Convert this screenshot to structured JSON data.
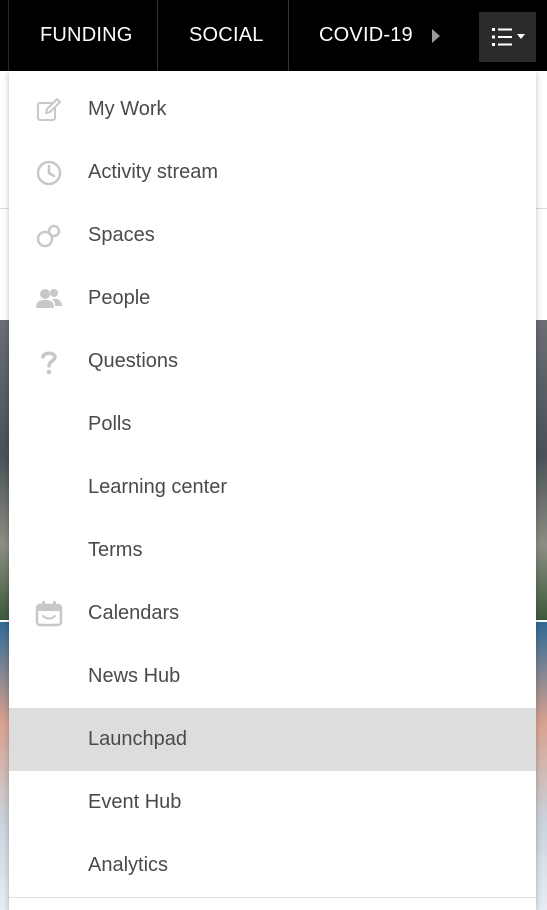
{
  "topnav": {
    "tabs": [
      {
        "label": "FUNDING"
      },
      {
        "label": "SOCIAL"
      },
      {
        "label": "COVID-19"
      }
    ],
    "scroll_right_icon": "caret-right-icon",
    "menu_toggle_icon": "list-menu-icon"
  },
  "menu": {
    "items": [
      {
        "label": "My Work",
        "icon": "edit-icon"
      },
      {
        "label": "Activity stream",
        "icon": "clock-icon"
      },
      {
        "label": "Spaces",
        "icon": "spaces-icon"
      },
      {
        "label": "People",
        "icon": "people-icon"
      },
      {
        "label": "Questions",
        "icon": "question-icon"
      },
      {
        "label": "Polls",
        "icon": ""
      },
      {
        "label": "Learning center",
        "icon": ""
      },
      {
        "label": "Terms",
        "icon": ""
      },
      {
        "label": "Calendars",
        "icon": "calendar-icon"
      },
      {
        "label": "News Hub",
        "icon": ""
      },
      {
        "label": "Launchpad",
        "icon": "",
        "active": true
      },
      {
        "label": "Event Hub",
        "icon": ""
      },
      {
        "label": "Analytics",
        "icon": ""
      }
    ]
  },
  "colors": {
    "topbar_bg": "#000000",
    "menu_text": "#4a4a4a",
    "icon_gray": "#c8c8c8",
    "active_bg": "#dddddd"
  }
}
